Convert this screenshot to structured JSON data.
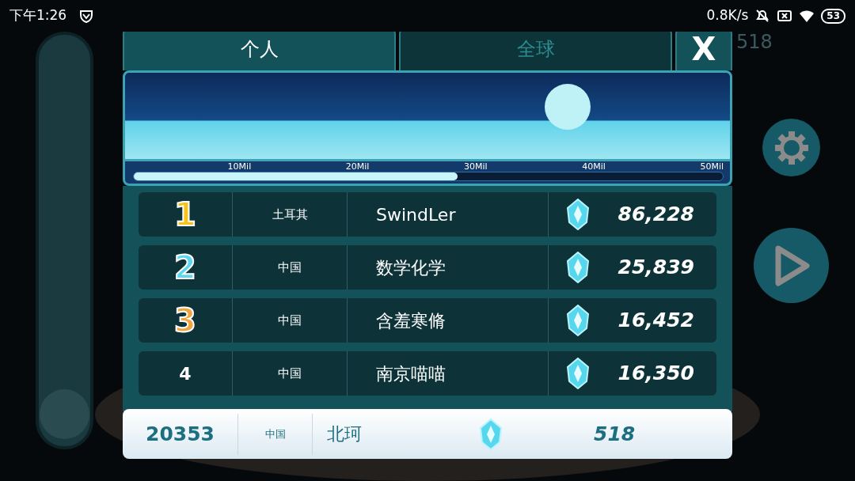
{
  "status_bar": {
    "time": "下午1:26",
    "speed": "0.8K/s",
    "battery": "53"
  },
  "hud": {
    "currency": "518"
  },
  "tabs": [
    {
      "label": "个人",
      "selected": true
    },
    {
      "label": "全球",
      "selected": false
    }
  ],
  "close": {
    "label": "X"
  },
  "progress": {
    "level": 0.55,
    "ticks": [
      "10Mil",
      "20Mil",
      "30Mil",
      "40Mil",
      "50Mil"
    ]
  },
  "rows": [
    {
      "rank": "1",
      "country": "土耳其",
      "name": "SwindLer",
      "score": "86,228",
      "color": "#f7c21a"
    },
    {
      "rank": "2",
      "country": "中国",
      "name": "数学化学",
      "score": "25,839",
      "color": "#5fd6f0"
    },
    {
      "rank": "3",
      "country": "中国",
      "name": "含羞寒脩",
      "score": "16,452",
      "color": "#f0a640"
    },
    {
      "rank": "4",
      "country": "中国",
      "name": "南京喵喵",
      "score": "16,350"
    }
  ],
  "me": {
    "rank": "20353",
    "country": "中国",
    "name": "北珂",
    "score": "518"
  }
}
